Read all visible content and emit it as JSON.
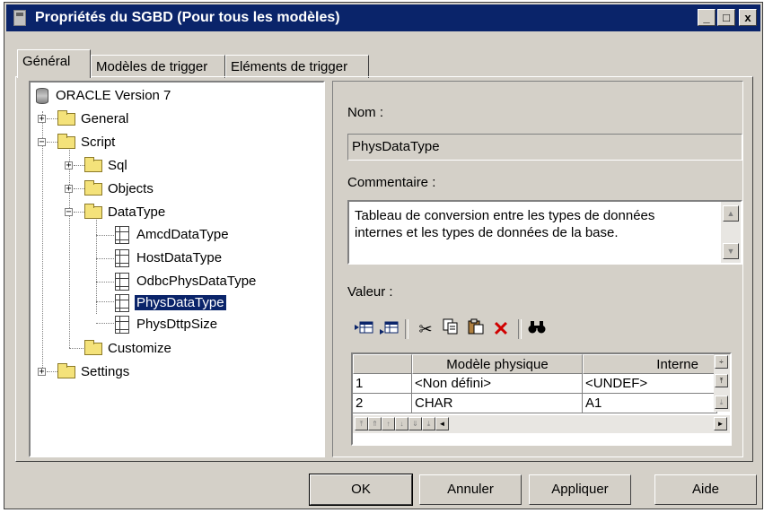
{
  "window": {
    "title": "Propriétés du SGBD (Pour tous les modèles)",
    "controls": [
      "_",
      "□",
      "x"
    ]
  },
  "tabs": [
    {
      "label": "Général",
      "active": true
    },
    {
      "label": "Modèles de trigger",
      "active": false
    },
    {
      "label": "Eléments de trigger",
      "active": false
    }
  ],
  "tree": {
    "root": "ORACLE Version 7",
    "nodes": {
      "general": "General",
      "script": "Script",
      "sql": "Sql",
      "objects": "Objects",
      "datatype": "DataType",
      "amcd": "AmcdDataType",
      "host": "HostDataType",
      "odbc": "OdbcPhysDataType",
      "phys": "PhysDataType",
      "physdttp": "PhysDttpSize",
      "customize": "Customize",
      "settings": "Settings"
    },
    "selected": "PhysDataType"
  },
  "form": {
    "nom_label": "Nom :",
    "nom_value": "PhysDataType",
    "commentaire_label": "Commentaire :",
    "commentaire_value": "Tableau de conversion entre les types de données internes et les types de données de la base.",
    "valeur_label": "Valeur :"
  },
  "grid": {
    "columns": [
      "",
      "Modèle physique",
      "Interne"
    ],
    "rows": [
      [
        "1",
        "<Non défini>",
        "<UNDEF>"
      ],
      [
        "2",
        "CHAR",
        "A1"
      ]
    ]
  },
  "buttons": {
    "ok": "OK",
    "annuler": "Annuler",
    "appliquer": "Appliquer",
    "aide": "Aide"
  }
}
